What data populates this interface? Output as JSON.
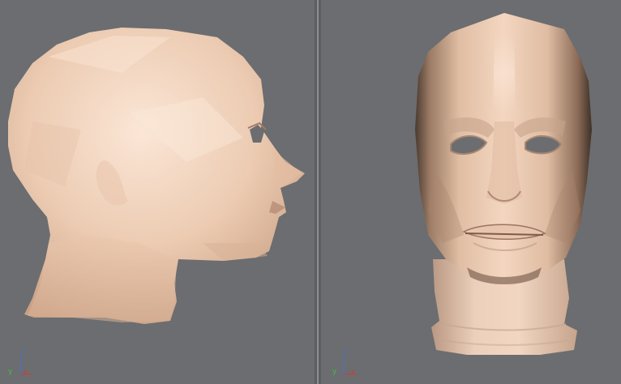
{
  "viewports": {
    "left": {
      "view": "side",
      "axes": {
        "z": "z",
        "y": "y",
        "x": "x"
      }
    },
    "right": {
      "view": "front",
      "axes": {
        "z": "z",
        "y": "y",
        "x": "x"
      }
    }
  },
  "colors": {
    "background": "#6b6d70",
    "skin_light": "#f6dcc8",
    "skin_mid": "#e0bba0",
    "skin_dark": "#5a4536",
    "axis_x": "#d03a3a",
    "axis_y": "#3fbf3f",
    "axis_z": "#4a6fd0"
  }
}
